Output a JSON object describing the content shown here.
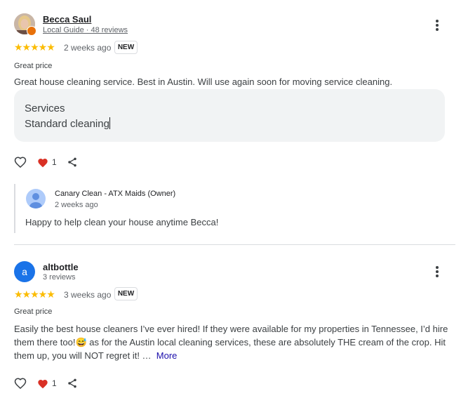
{
  "reviews": [
    {
      "reviewer_name": "Becca Saul",
      "reviewer_sub": "Local Guide · 48 reviews",
      "stars": "★★★★★",
      "rating": 5,
      "time": "2 weeks ago",
      "badge": "NEW",
      "tag": "Great price",
      "text": "Great house cleaning service. Best in Austin. Will use again soon for moving service cleaning.",
      "service_heading": "Services",
      "service_value": "Standard cleaning",
      "like_count": "1",
      "owner_reply": {
        "name": "Canary Clean - ATX Maids (Owner)",
        "time": "2 weeks ago",
        "text": "Happy to help clean your house anytime Becca!"
      }
    },
    {
      "avatar_letter": "a",
      "reviewer_name": "altbottle",
      "reviewer_sub": "3 reviews",
      "stars": "★★★★★",
      "rating": 5,
      "time": "3 weeks ago",
      "badge": "NEW",
      "tag": "Great price",
      "text": "Easily the best house cleaners I’ve ever hired! If they were available for my properties in Tennessee, I’d hire them there too!😅 as for the Austin local cleaning services, these are absolutely THE cream of the crop. Hit them up, you will NOT regret it! …",
      "more_label": "More",
      "like_count": "1"
    }
  ],
  "colors": {
    "star": "#fbbc04",
    "heart": "#d93025",
    "link": "#1a0dab",
    "avatar_blue": "#1a73e8",
    "local_guide_badge": "#e8710a"
  },
  "icons": [
    "more-vert-icon",
    "thumb-like-icon",
    "heart-icon",
    "share-icon",
    "local-guide-badge-icon",
    "person-icon"
  ]
}
